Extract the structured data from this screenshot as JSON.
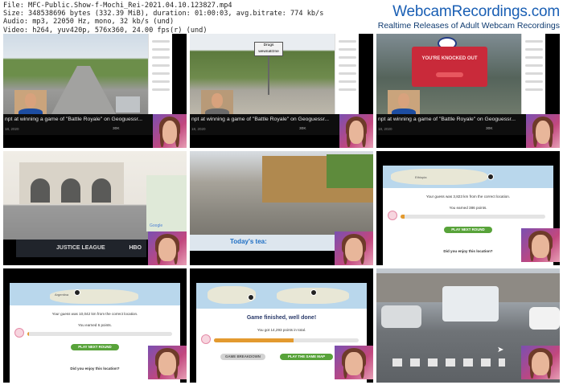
{
  "meta": {
    "file": "File: MFC-Public.Show-f-Mochi_Rei-2021.04.10.123827.mp4",
    "size": "Size: 348538696 bytes (332.39 MiB), duration: 01:00:03, avg.bitrate: 774 kb/s",
    "audio": "Audio: mp3, 22050 Hz, mono, 32 kb/s (und)",
    "video": "Video: h264, yuv420p, 576x360, 24.00 fps(r) (und)"
  },
  "brand": {
    "logo": "WebcamRecordings.com",
    "tagline": "Realtime Releases of Adult Webcam Recordings"
  },
  "tiles": {
    "t1": {
      "title": "npt at winning a game of \"Battle Royale\" on Geoguessr...",
      "date": "18, 2020",
      "likes": "30K"
    },
    "t2": {
      "title": "npt at winning a game of \"Battle Royale\" on Geoguessr...",
      "date": "18, 2020",
      "likes": "30K",
      "sign1": "Drugs",
      "sign2": "wewnatrzne"
    },
    "t3": {
      "title": "npt at winning a game of \"Battle Royale\" on Geoguessr...",
      "date": "18, 2020",
      "likes": "30K",
      "modal_title": "YOU'RE KNOCKED OUT"
    },
    "t4": {
      "banner": "JUSTICE LEAGUE",
      "banner2": "HBO",
      "map_logo": "Google"
    },
    "t5": {
      "headline": "Today's tea:"
    },
    "t6": {
      "result_line": "Your guess was 3,823 km from the correct location.",
      "points": "You earned 386 points.",
      "button": "PLAY NEXT ROUND",
      "question": "Did you enjoy this location?",
      "map_label": "Ethiopia"
    },
    "t7": {
      "result_line": "Your guess was 10,042 km from the correct location.",
      "points": "You earned 6 points.",
      "button": "PLAY NEXT ROUND",
      "question": "Did you enjoy this location?",
      "map_label": "Argentina"
    },
    "t8": {
      "headline": "Game finished, well done!",
      "total": "You got 14,293 points in total.",
      "button_left": "GAME BREAKDOWN",
      "button_right": "PLAY THE SAME MAP",
      "progress": 0.55
    },
    "t9": {}
  },
  "colors": {
    "brand": "#1a5fb4",
    "button_green": "#58a33a",
    "progress": "#e39a2f",
    "modal": "#c92a3a"
  }
}
